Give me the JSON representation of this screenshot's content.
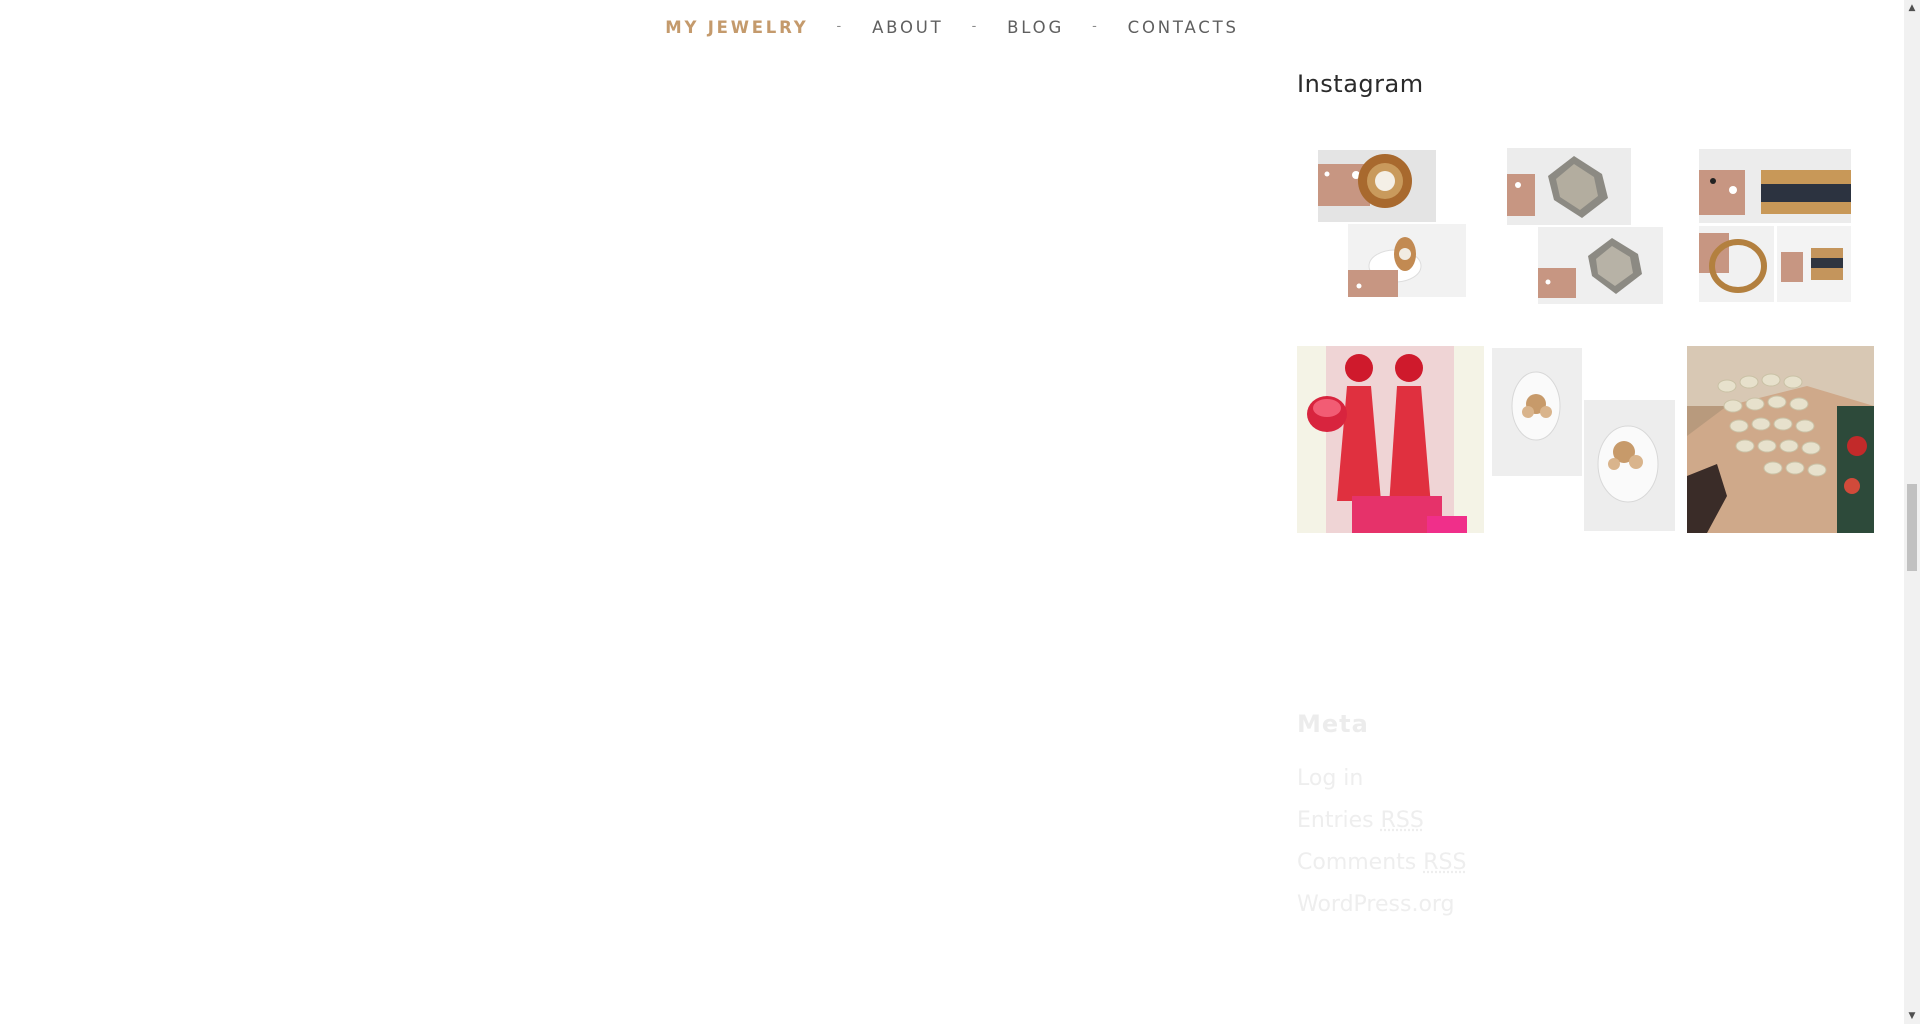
{
  "nav": {
    "items": [
      {
        "label": "MY JEWELRY"
      },
      {
        "label": "ABOUT"
      },
      {
        "label": "BLOG"
      },
      {
        "label": "CONTACTS"
      }
    ],
    "separator": "-",
    "active_color": "#c49a6c",
    "text_color": "#5f5f5f"
  },
  "sidebar": {
    "instagram": {
      "title": "Instagram",
      "photos": [
        {
          "icon": "pearl-ring-photo"
        },
        {
          "icon": "crystal-ring-photo"
        },
        {
          "icon": "band-ring-photo"
        },
        {
          "icon": "red-tassel-earrings-photo"
        },
        {
          "icon": "flower-ring-photo"
        },
        {
          "icon": "bead-necklace-photo"
        }
      ]
    },
    "meta": {
      "title": "Meta",
      "links": {
        "login": "Log in",
        "entries_prefix": "Entries",
        "comments_prefix": "Comments",
        "rss": "RSS",
        "wordpress": "WordPress.org"
      }
    }
  },
  "scrollbar": {
    "up_arrow": "▲",
    "down_arrow": "▼"
  }
}
